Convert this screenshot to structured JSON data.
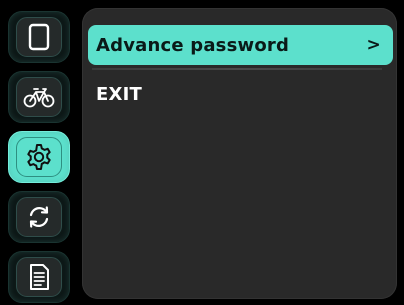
{
  "sidebar": {
    "items": [
      {
        "icon": "tablet-icon",
        "active": false
      },
      {
        "icon": "bicycle-icon",
        "active": false
      },
      {
        "icon": "gear-icon",
        "active": true
      },
      {
        "icon": "sync-icon",
        "active": false
      },
      {
        "icon": "document-icon",
        "active": false
      }
    ]
  },
  "menu": {
    "items": [
      {
        "label": "Advance password",
        "chevron": ">",
        "selected": true
      },
      {
        "label": "EXIT",
        "selected": false
      }
    ]
  },
  "colors": {
    "accent": "#5ce0cc",
    "panel": "#292929",
    "background": "#000000"
  }
}
